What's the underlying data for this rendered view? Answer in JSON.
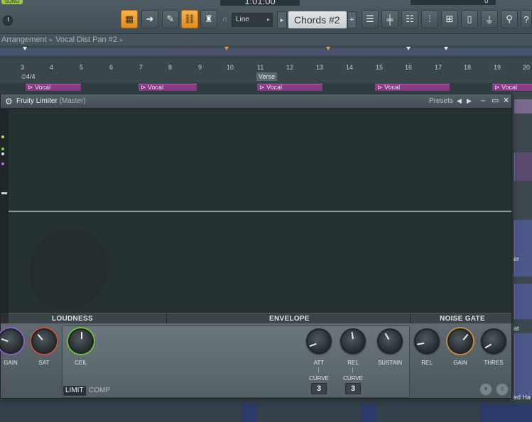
{
  "toolbar": {
    "song_label": "SONG",
    "time_display": "1:01:00",
    "snap_mode": "Line",
    "pattern_name": "Chords #2",
    "pattern_add": "+",
    "pattern_prev": "▸",
    "slider_value": "0"
  },
  "breadcrumb": {
    "items": [
      "Arrangement",
      "Vocal Dist Pan #2"
    ]
  },
  "ruler": {
    "bars": [
      "3",
      "4",
      "5",
      "6",
      "7",
      "8",
      "9",
      "10",
      "11",
      "12",
      "13",
      "14",
      "15",
      "16",
      "17",
      "18",
      "19",
      "20"
    ],
    "time_signature": "4/4",
    "marker": "Verse"
  },
  "vocal_track": {
    "clips": [
      "Vocal",
      "Vocal",
      "Vocal",
      "Vocal",
      "Vocal"
    ]
  },
  "right_tracks": {
    "labels": [
      "er",
      "at",
      "ed Ha"
    ]
  },
  "plugin": {
    "title": "Fruity Limiter",
    "host": "(Master)",
    "presets_label": "Presets",
    "sections": {
      "loudness": "LOUDNESS",
      "envelope": "ENVELOPE",
      "noise_gate": "NOISE GATE"
    },
    "knobs": {
      "gain": "GAIN",
      "sat": "SAT",
      "ceil": "CEIL",
      "att": "ATT",
      "rel": "REL",
      "sustain": "SUSTAIN",
      "gate_rel": "REL",
      "gate_gain": "GAIN",
      "thres": "THRES"
    },
    "curve_label": "CURVE",
    "att_curve": "3",
    "rel_curve": "3",
    "modes": [
      "LIMIT",
      "COMP"
    ],
    "active_mode": "LIMIT"
  },
  "colors": {
    "accent": "#f0a83a",
    "clip": "#8a3a87",
    "display_bg": "#263232",
    "panel_bg": "#566166"
  }
}
